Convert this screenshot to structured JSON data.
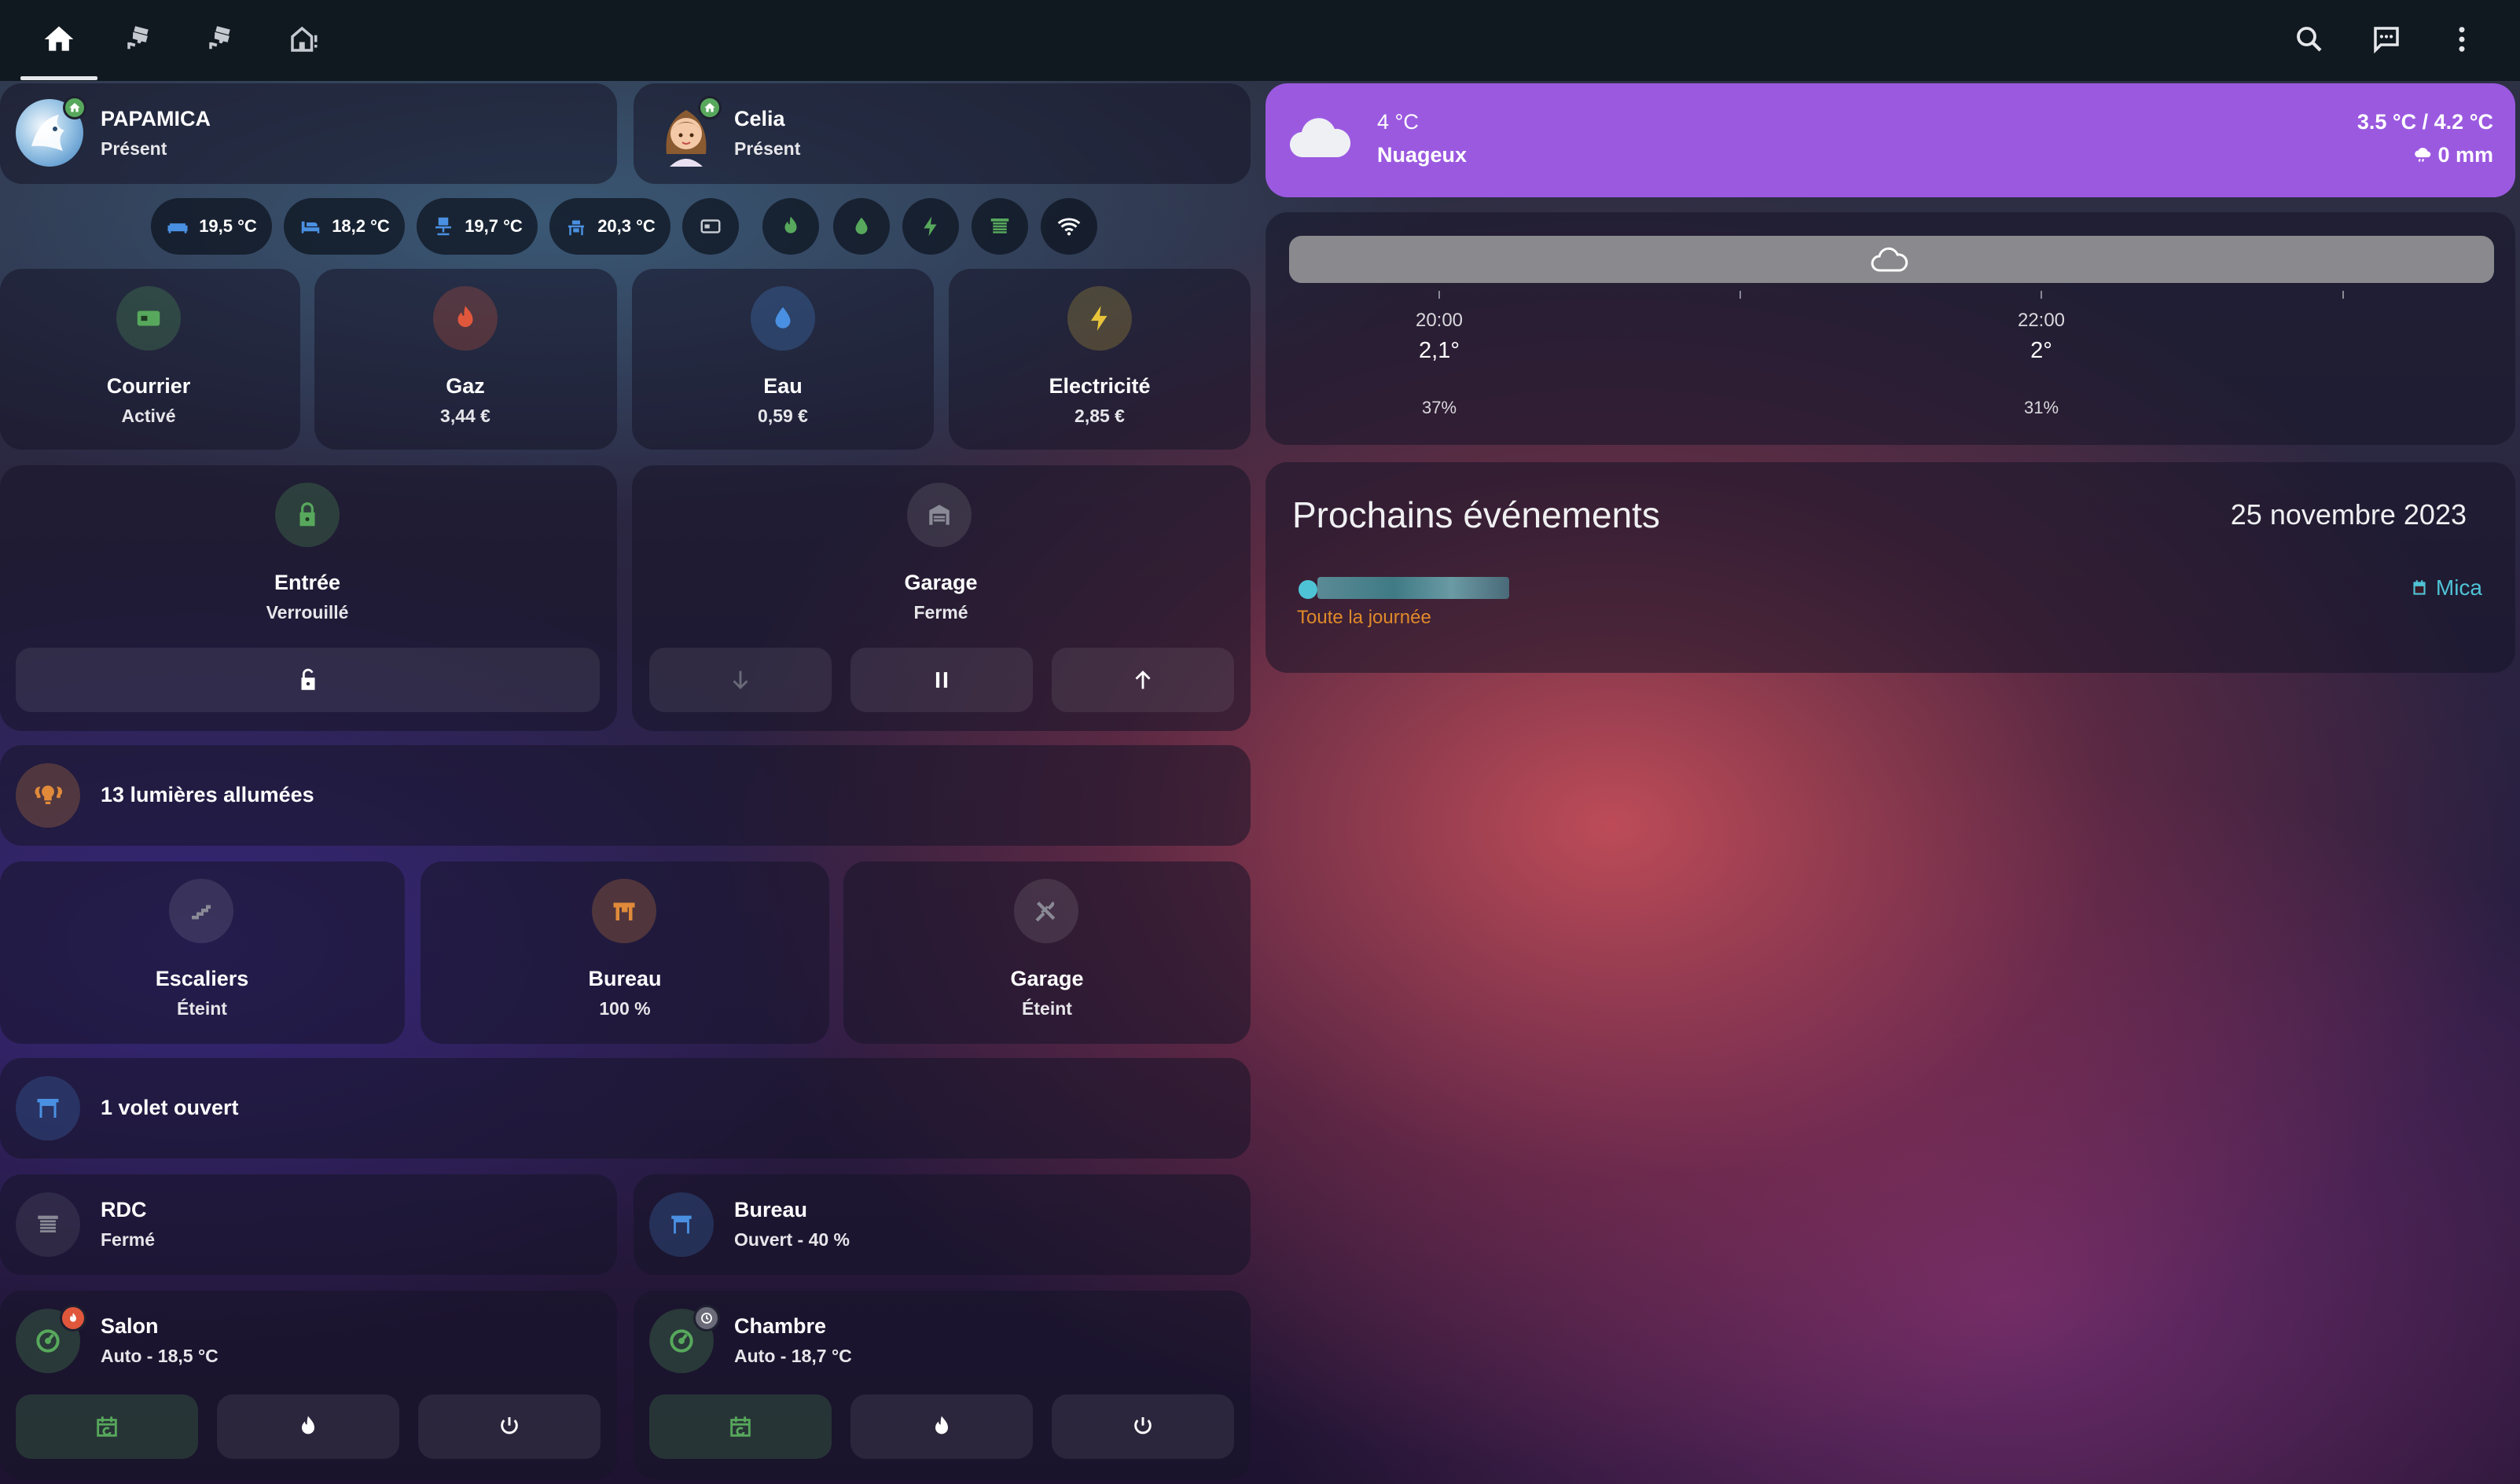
{
  "colors": {
    "accent_green": "#57a85c",
    "gas_red": "#e0573c",
    "water_blue": "#4a90e2",
    "power_yellow": "#e8c43a",
    "orange": "#e08a3a",
    "weather_purple": "#9b59e0",
    "calendar_cyan": "#4fc3d6",
    "all_day_orange": "#e08a2a"
  },
  "toolbar": {
    "tabs": [
      {
        "icon": "home-icon"
      },
      {
        "icon": "cctv-icon"
      },
      {
        "icon": "cctv-icon"
      },
      {
        "icon": "home-sensor-icon"
      }
    ],
    "actions": [
      {
        "icon": "search-icon"
      },
      {
        "icon": "assist-chat-icon"
      },
      {
        "icon": "overflow-menu-icon"
      }
    ]
  },
  "persons": [
    {
      "name": "PAPAMICA",
      "state": "Présent",
      "avatar": "wolf-avatar"
    },
    {
      "name": "Celia",
      "state": "Présent",
      "avatar": "woman-avatar"
    }
  ],
  "chips": {
    "temps": [
      {
        "icon": "sofa-icon",
        "value": "19,5 °C"
      },
      {
        "icon": "bed-icon",
        "value": "18,2 °C"
      },
      {
        "icon": "desk-chair-icon",
        "value": "19,7 °C"
      },
      {
        "icon": "baby-bed-icon",
        "value": "20,3 °C"
      }
    ],
    "icons": [
      {
        "icon": "mailbox-icon"
      },
      {
        "icon": "fire-icon"
      },
      {
        "icon": "water-icon"
      },
      {
        "icon": "lightning-icon"
      },
      {
        "icon": "shutter-icon"
      },
      {
        "icon": "wifi-icon"
      }
    ]
  },
  "utilities": [
    {
      "name": "Courrier",
      "state": "Activé",
      "icon": "mailbox-icon"
    },
    {
      "name": "Gaz",
      "state": "3,44 €",
      "icon": "fire-icon"
    },
    {
      "name": "Eau",
      "state": "0,59 €",
      "icon": "water-icon"
    },
    {
      "name": "Electricité",
      "state": "2,85 €",
      "icon": "lightning-icon"
    }
  ],
  "lock": {
    "name": "Entrée",
    "state": "Verrouillé"
  },
  "garage_door": {
    "name": "Garage",
    "state": "Fermé"
  },
  "lights": {
    "summary": "13 lumières allumées",
    "rooms": [
      {
        "name": "Escaliers",
        "state": "Éteint",
        "icon": "stairs-icon"
      },
      {
        "name": "Bureau",
        "state": "100 %",
        "icon": "desk-icon"
      },
      {
        "name": "Garage",
        "state": "Éteint",
        "icon": "tools-icon"
      }
    ]
  },
  "covers": {
    "summary": "1 volet ouvert",
    "items": [
      {
        "name": "RDC",
        "state": "Fermé"
      },
      {
        "name": "Bureau",
        "state": "Ouvert - 40 %"
      }
    ]
  },
  "climate": [
    {
      "name": "Salon",
      "state": "Auto - 18,5 °C",
      "badge": "flame-badge"
    },
    {
      "name": "Chambre",
      "state": "Auto - 18,7 °C",
      "badge": "clock-badge"
    }
  ],
  "weather": {
    "temp": "4 °C",
    "condition": "Nuageux",
    "range": "3.5 °C / 4.2 °C",
    "precipitation": "0 mm"
  },
  "forecast": {
    "hours": [
      {
        "time": "20:00",
        "temp": "2,1°",
        "humidity": "37%"
      },
      {
        "time": "22:00",
        "temp": "2°",
        "humidity": "31%"
      }
    ]
  },
  "calendar": {
    "title": "Prochains événements",
    "date": "25 novembre 2023",
    "event_time": "Toute la journée",
    "calendar_name": "Mica"
  }
}
